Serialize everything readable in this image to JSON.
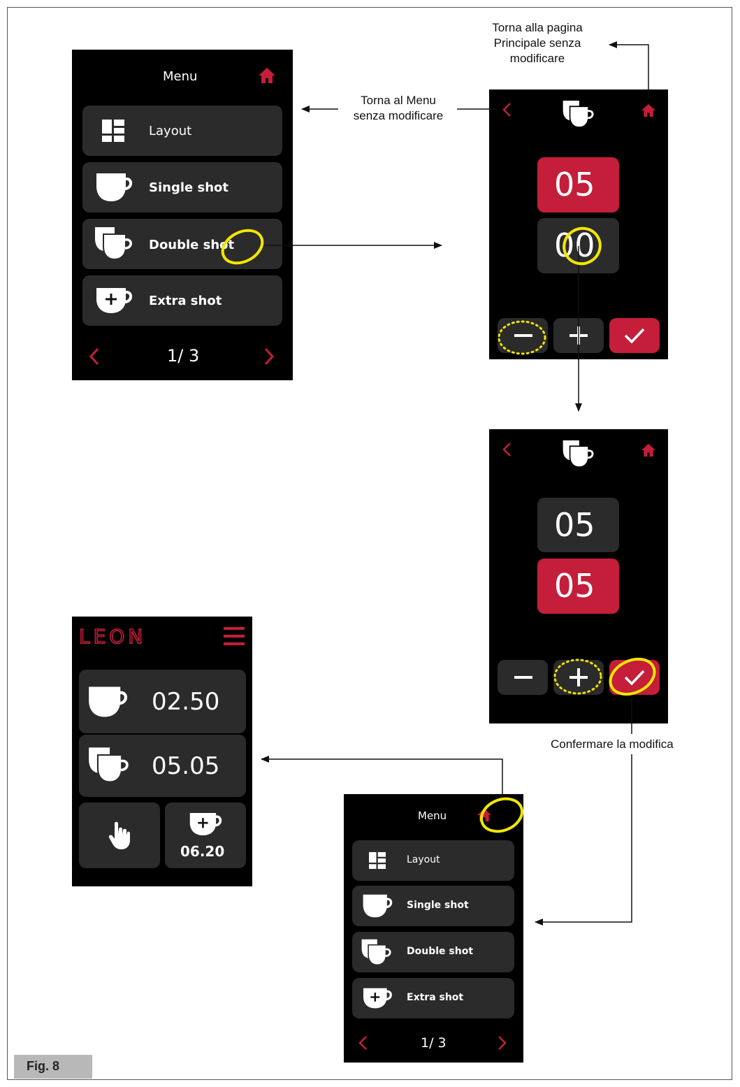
{
  "annotations": {
    "home_note": [
      "Torna alla pagina",
      "Principale senza",
      "modificare"
    ],
    "back_note": [
      "Torna al Menu",
      "senza modificare"
    ],
    "confirm_note": "Confermare la modifica",
    "figure_label": "Fig. 8"
  },
  "menu_screen": {
    "title": "Menu",
    "items": [
      {
        "label": "Layout",
        "icon": "layout-icon"
      },
      {
        "label": "Single shot",
        "icon": "single-cup-icon"
      },
      {
        "label": "Double shot",
        "icon": "double-cup-icon"
      },
      {
        "label": "Extra shot",
        "icon": "extra-cup-icon"
      }
    ],
    "page": "1/ 3"
  },
  "edit_screen_1": {
    "top_value": "05",
    "bottom_value": "00",
    "selected": "top"
  },
  "edit_screen_2": {
    "top_value": "05",
    "bottom_value": "05",
    "selected": "bottom"
  },
  "home_screen": {
    "brand": "LEON",
    "single_time": "02.50",
    "double_time": "05.05",
    "extra_time": "06.20"
  },
  "menu_screen_2": {
    "title": "Menu",
    "items": [
      {
        "label": "Layout",
        "icon": "layout-icon"
      },
      {
        "label": "Single shot",
        "icon": "single-cup-icon"
      },
      {
        "label": "Double shot",
        "icon": "double-cup-icon"
      },
      {
        "label": "Extra shot",
        "icon": "extra-cup-icon"
      }
    ],
    "page": "1/ 3"
  },
  "colors": {
    "accent": "#c41e3a",
    "tile": "#2b2b2b",
    "highlight": "#f3e600"
  }
}
